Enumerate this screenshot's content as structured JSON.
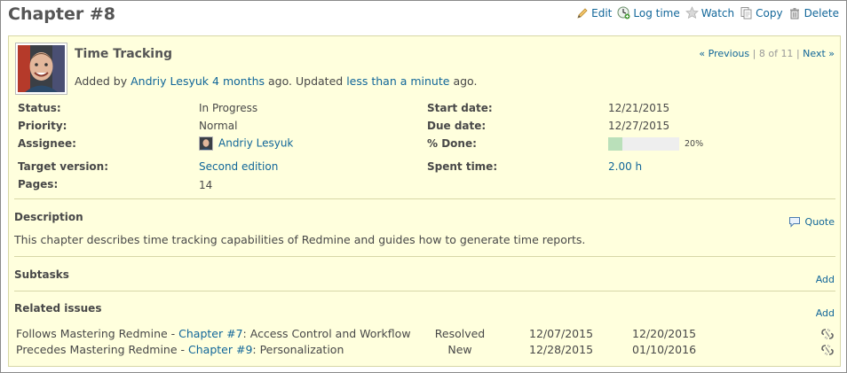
{
  "header": {
    "title": "Chapter #8",
    "actions": {
      "edit": "Edit",
      "log_time": "Log time",
      "watch": "Watch",
      "copy": "Copy",
      "delete": "Delete"
    }
  },
  "issue": {
    "subject": "Time Tracking",
    "nav": {
      "previous": "« Previous",
      "position": "8 of 11",
      "next": "Next »"
    },
    "author_line": {
      "added_by": "Added by",
      "author": "Andriy Lesyuk",
      "added_ago": "4 months",
      "ago_updated": "ago. Updated",
      "updated_ago": "less than a minute",
      "ago_end": "ago."
    },
    "attributes": {
      "status_label": "Status:",
      "status": "In Progress",
      "priority_label": "Priority:",
      "priority": "Normal",
      "assignee_label": "Assignee:",
      "assignee": "Andriy Lesyuk",
      "target_version_label": "Target version:",
      "target_version": "Second edition",
      "pages_label": "Pages:",
      "pages": "14",
      "start_date_label": "Start date:",
      "start_date": "12/21/2015",
      "due_date_label": "Due date:",
      "due_date": "12/27/2015",
      "done_label": "% Done:",
      "done_text": "20%",
      "done_fraction": 0.2,
      "spent_time_label": "Spent time:",
      "spent_time": "2.00 h"
    },
    "description": {
      "heading": "Description",
      "quote_label": "Quote",
      "text": "This chapter describes time tracking capabilities of Redmine and guides how to generate time reports."
    },
    "subtasks": {
      "heading": "Subtasks",
      "add_label": "Add"
    },
    "related": {
      "heading": "Related issues",
      "add_label": "Add",
      "rows": [
        {
          "prefix": "Follows Mastering Redmine - ",
          "link": "Chapter #7",
          "suffix": ": Access Control and Workflow",
          "status": "Resolved",
          "start": "12/07/2015",
          "due": "12/20/2015"
        },
        {
          "prefix": "Precedes Mastering Redmine - ",
          "link": "Chapter #9",
          "suffix": ": Personalization",
          "status": "New",
          "start": "12/28/2015",
          "due": "01/10/2016"
        }
      ]
    }
  },
  "colors": {
    "link": "#116699",
    "box_background": "#ffffdd",
    "box_border": "#d7d7a7",
    "progress_fill": "#bae0ba"
  },
  "icons": {
    "edit": "pencil-icon",
    "log_time": "clock-add-icon",
    "watch": "star-icon",
    "copy": "copy-icon",
    "delete": "trash-icon",
    "quote": "speech-bubble-icon",
    "unlink": "broken-link-icon"
  }
}
